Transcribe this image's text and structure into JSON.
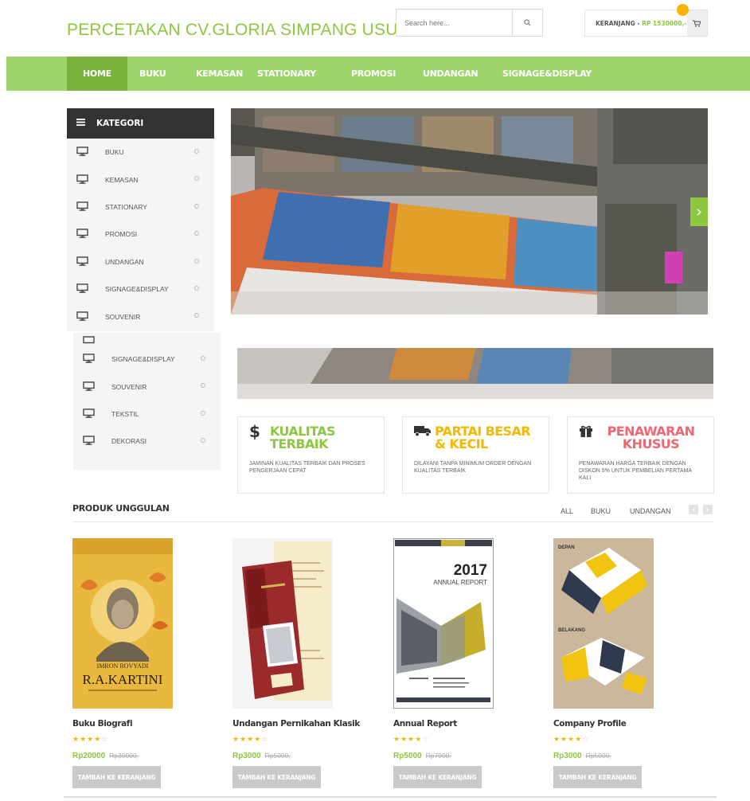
{
  "header": {
    "brand": "PERCETAKAN CV.GLORIA SIMPANG USU",
    "search_placeholder": "Search here...",
    "cart_label": "KERANJANG - ",
    "cart_amount": "RP 1530000,-"
  },
  "nav": [
    {
      "label": "HOME"
    },
    {
      "label": "BUKU"
    },
    {
      "label": "KEMASAN"
    },
    {
      "label": "STATIONARY"
    },
    {
      "label": "PROMOSI"
    },
    {
      "label": "UNDANGAN"
    },
    {
      "label": "SIGNAGE&DISPLAY"
    }
  ],
  "sidebar": {
    "title": "KATEGORI",
    "items": [
      {
        "label": "BUKU"
      },
      {
        "label": "KEMASAN"
      },
      {
        "label": "STATIONARY"
      },
      {
        "label": "PROMOSI"
      },
      {
        "label": "UNDANGAN"
      },
      {
        "label": "SIGNAGE&DISPLAY"
      },
      {
        "label": "SOUVENIR"
      }
    ],
    "items_more": [
      {
        "label": "SIGNAGE&DISPLAY"
      },
      {
        "label": "SOUVENIR"
      },
      {
        "label": "TEKSTIL"
      },
      {
        "label": "DEKORASI"
      }
    ]
  },
  "features": [
    {
      "icon": "dollar-icon",
      "glyph": "$",
      "title": "KUALITAS TERBAIK",
      "color": "#8dc63f",
      "desc": "JAMINAN KUALITAS TERBAIK DAN PROSES PENGERJAAN CEPAT"
    },
    {
      "icon": "truck-icon",
      "glyph": "",
      "title": "PARTAI BESAR & KECIL",
      "color": "#f5b800",
      "desc": "DILAYANI TANPA MINIMUM ORDER DENGAN KUALITAS TERBAIK"
    },
    {
      "icon": "gift-icon",
      "glyph": "",
      "title": "PENAWARAN KHUSUS",
      "color": "#f06673",
      "desc": "PENAWARAN HARGA TERBAIK DENGAN DISKON 5% UNTUK PEMBELIAN PERTAMA KALI"
    }
  ],
  "products_section": {
    "title": "PRODUK UNGGULAN",
    "filters": [
      "ALL",
      "BUKU",
      "UNDANGAN"
    ]
  },
  "products": [
    {
      "name": "Buku Biografi",
      "rating": 4,
      "price": "Rp20000",
      "old_price": "Rp30000,",
      "button": "TAMBAH KE KERANJANG",
      "cover_author": "IMRON ROVYADI",
      "cover_title": "R.A.KARTINI"
    },
    {
      "name": "Undangan Pernikahan Klasik",
      "rating": 4,
      "price": "Rp3000",
      "old_price": "Rp5000,",
      "button": "TAMBAH KE KERANJANG"
    },
    {
      "name": "Annual Report",
      "rating": 4,
      "price": "Rp5000",
      "old_price": "Rp7000,",
      "button": "TAMBAH KE KERANJANG",
      "cover_year": "2017",
      "cover_title": "ANNUAL REPORT"
    },
    {
      "name": "Company Profile",
      "rating": 4,
      "price": "Rp3000",
      "old_price": "Rp5000,",
      "button": "TAMBAH KE KERANJANG",
      "label_front": "DEPAN",
      "label_back": "BELAKANG"
    }
  ],
  "colors": {
    "brand": "#8dc63f",
    "nav": "#9ed46c",
    "nav_active": "#7bb33f",
    "star": "#f2b600"
  }
}
